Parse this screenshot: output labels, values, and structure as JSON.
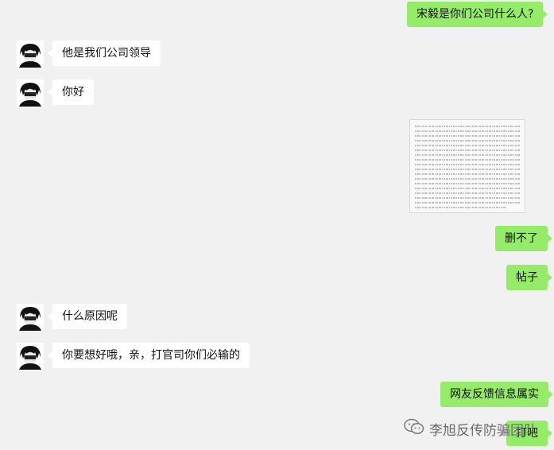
{
  "messages": [
    {
      "side": "right",
      "text": "宋毅是你们公司什么人?"
    },
    {
      "side": "left",
      "text": "他是我们公司领导"
    },
    {
      "side": "left",
      "text": "你好"
    },
    {
      "side": "right",
      "type": "image"
    },
    {
      "side": "right",
      "text": "删不了"
    },
    {
      "side": "right",
      "text": "帖子"
    },
    {
      "side": "left",
      "text": "什么原因呢"
    },
    {
      "side": "left",
      "text": "你要想好哦，亲，打官司你们必输的"
    },
    {
      "side": "right",
      "text": "网友反馈信息属实"
    },
    {
      "side": "right",
      "text": "打吧"
    }
  ],
  "watermark": {
    "text": "李旭反传防骗团队",
    "icon": "wechat-icon"
  }
}
